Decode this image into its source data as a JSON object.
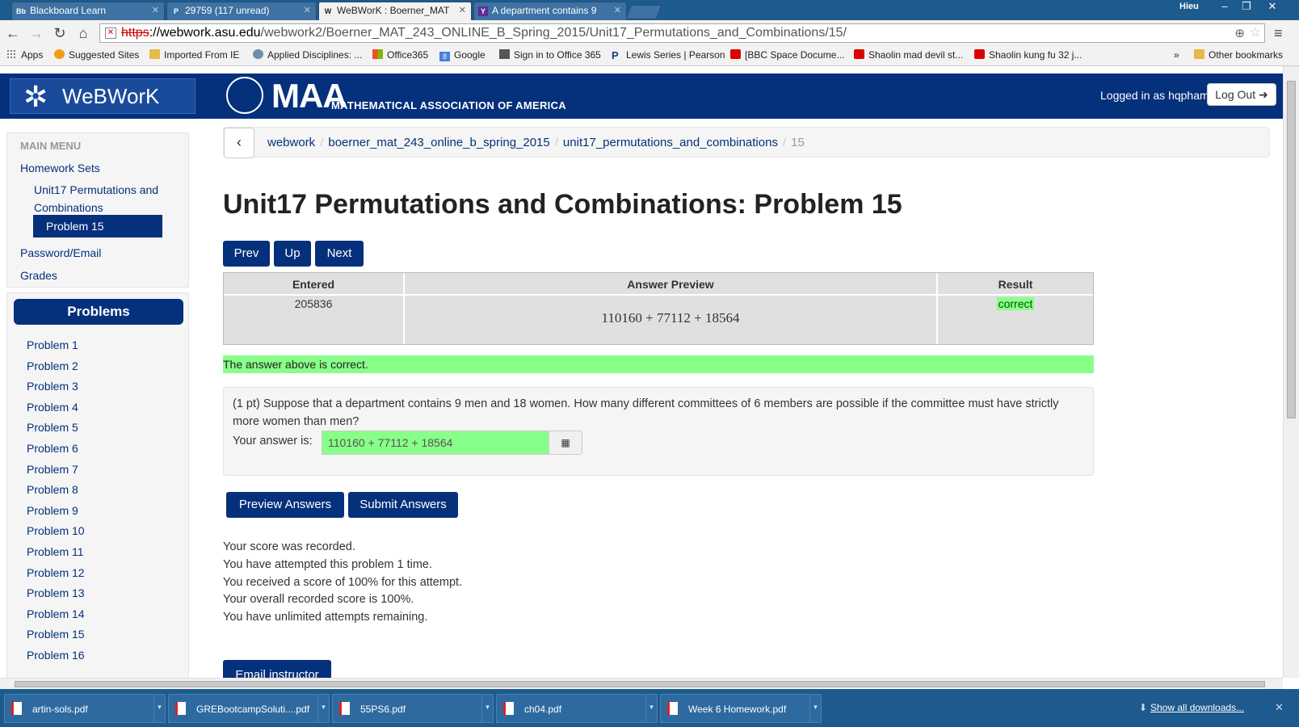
{
  "browser": {
    "tabs": [
      {
        "label": "Blackboard Learn",
        "icon": "Bb"
      },
      {
        "label": "29759 (117 unread)",
        "icon": "P"
      },
      {
        "label": "WeBWorK : Boerner_MAT",
        "icon": "W"
      },
      {
        "label": "A department contains 9",
        "icon": "Y"
      }
    ],
    "window_user": "Hieu",
    "window_controls": [
      "–",
      "❐",
      "✕"
    ],
    "url_protocol": "https",
    "url_host": "://webwork.asu.edu",
    "url_path": "/webwork2/Boerner_MAT_243_ONLINE_B_Spring_2015/Unit17_Permutations_and_Combinations/15/",
    "bookmarks": [
      {
        "label": "Apps",
        "icon": "apps-icon"
      },
      {
        "label": "Suggested Sites",
        "icon": "sun-icon"
      },
      {
        "label": "Imported From IE",
        "icon": "folder-icon"
      },
      {
        "label": "Applied Disciplines: ...",
        "icon": "globe-icon"
      },
      {
        "label": "Office365",
        "icon": "ms-icon"
      },
      {
        "label": "Google",
        "icon": "google-icon"
      },
      {
        "label": "Sign in to Office 365",
        "icon": "office-icon"
      },
      {
        "label": "Lewis Series | Pearson",
        "icon": "pearson-icon"
      },
      {
        "label": "[BBC Space Docume...",
        "icon": "youtube-icon"
      },
      {
        "label": "Shaolin mad devil st...",
        "icon": "youtube-icon"
      },
      {
        "label": "Shaolin kung fu 32 j...",
        "icon": "youtube-icon"
      },
      {
        "label": "»",
        "icon": ""
      },
      {
        "label": "Other bookmarks",
        "icon": "folder-icon"
      }
    ]
  },
  "header": {
    "logo_text": "WeBWorK",
    "maa_big": "MAA",
    "maa_small": "MATHEMATICAL ASSOCIATION OF AMERICA",
    "logged_in_text": "Logged in as hqpham.",
    "logout_label": "Log Out"
  },
  "main_menu": {
    "heading": "MAIN MENU",
    "homework_sets": "Homework Sets",
    "set_name_line1": "Unit17 Permutations and",
    "set_name_line2": "Combinations",
    "active_problem": "Problem 15",
    "password_email": "Password/Email",
    "grades": "Grades"
  },
  "problems_panel": {
    "heading": "Problems",
    "items": [
      "Problem 1",
      "Problem 2",
      "Problem 3",
      "Problem 4",
      "Problem 5",
      "Problem 6",
      "Problem 7",
      "Problem 8",
      "Problem 9",
      "Problem 10",
      "Problem 11",
      "Problem 12",
      "Problem 13",
      "Problem 14",
      "Problem 15",
      "Problem 16"
    ]
  },
  "breadcrumb": {
    "back_symbol": "‹",
    "items": [
      "webwork",
      "boerner_mat_243_online_b_spring_2015",
      "unit17_permutations_and_combinations"
    ],
    "separator": "/",
    "current": "15"
  },
  "page_title": "Unit17 Permutations and Combinations: Problem 15",
  "nav_buttons": {
    "prev": "Prev",
    "up": "Up",
    "next": "Next"
  },
  "results_table": {
    "headers": [
      "Entered",
      "Answer Preview",
      "Result"
    ],
    "entered": "205836",
    "preview": "110160 + 77112 + 18564",
    "result": "correct"
  },
  "correct_message": "The answer above is correct.",
  "problem": {
    "text": "(1 pt) Suppose that a department contains 9 men and 18 women. How many different committees of 6 members are possible if the committee must have strictly more women than men?",
    "answer_label": "Your answer is:",
    "answer_value": "110160 + 77112 + 18564"
  },
  "actions": {
    "preview": "Preview Answers",
    "submit": "Submit Answers"
  },
  "score_messages": [
    "Your score was recorded.",
    "You have attempted this problem 1 time.",
    "You received a score of 100% for this attempt.",
    "Your overall recorded score is 100%.",
    "You have unlimited attempts remaining."
  ],
  "email_instructor": "Email instructor",
  "downloads": {
    "items": [
      "artin-sols.pdf",
      "GREBootcampSoluti....pdf",
      "55PS6.pdf",
      "ch04.pdf",
      "Week 6 Homework.pdf"
    ],
    "show_all": "Show all downloads..."
  },
  "colors": {
    "brand_blue": "#05307c",
    "correct_green": "#88ff88",
    "browser_frame": "#1d5a8e"
  }
}
